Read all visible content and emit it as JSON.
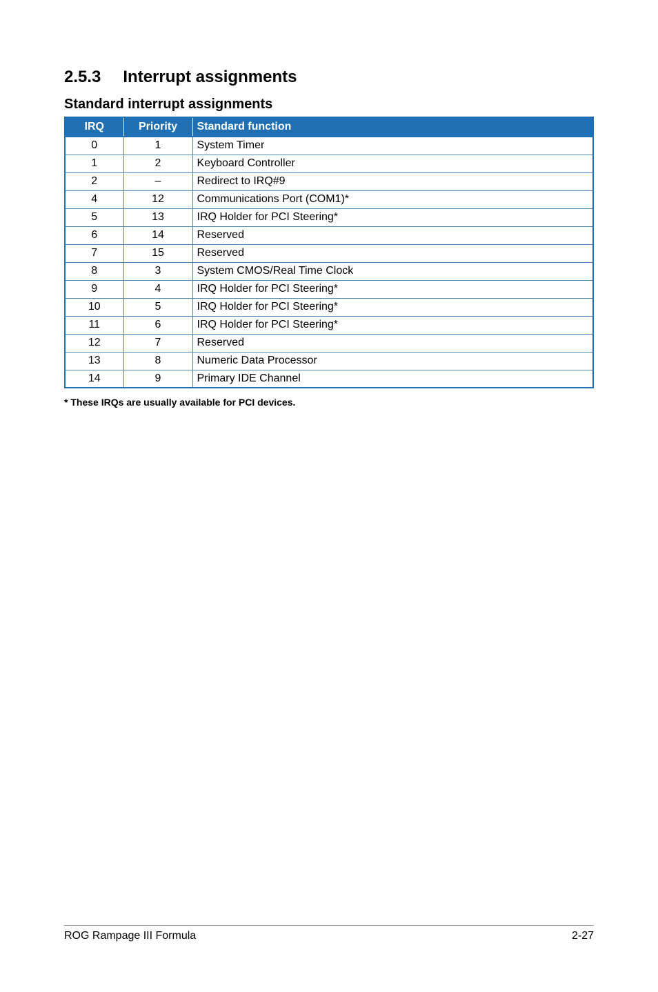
{
  "section": {
    "number": "2.5.3",
    "title": "Interrupt assignments"
  },
  "subheading": "Standard interrupt assignments",
  "table": {
    "headers": {
      "irq": "IRQ",
      "priority": "Priority",
      "func": "Standard function"
    },
    "rows": [
      {
        "irq": "0",
        "priority": "1",
        "func": "System Timer"
      },
      {
        "irq": "1",
        "priority": "2",
        "func": "Keyboard Controller"
      },
      {
        "irq": "2",
        "priority": "–",
        "func": "Redirect to IRQ#9"
      },
      {
        "irq": "4",
        "priority": "12",
        "func": "Communications Port (COM1)*"
      },
      {
        "irq": "5",
        "priority": "13",
        "func": "IRQ Holder for PCI Steering*"
      },
      {
        "irq": "6",
        "priority": "14",
        "func": "Reserved"
      },
      {
        "irq": "7",
        "priority": "15",
        "func": "Reserved"
      },
      {
        "irq": "8",
        "priority": "3",
        "func": "System CMOS/Real Time Clock"
      },
      {
        "irq": "9",
        "priority": "4",
        "func": "IRQ Holder for PCI Steering*"
      },
      {
        "irq": "10",
        "priority": "5",
        "func": "IRQ Holder for PCI Steering*"
      },
      {
        "irq": "11",
        "priority": "6",
        "func": "IRQ Holder for PCI Steering*"
      },
      {
        "irq": "12",
        "priority": "7",
        "func": "Reserved"
      },
      {
        "irq": "13",
        "priority": "8",
        "func": "Numeric Data Processor"
      },
      {
        "irq": "14",
        "priority": "9",
        "func": "Primary IDE Channel"
      }
    ]
  },
  "footnote": "* These IRQs are usually available for PCI devices.",
  "footer": {
    "left": "ROG Rampage III Formula",
    "right": "2-27"
  }
}
